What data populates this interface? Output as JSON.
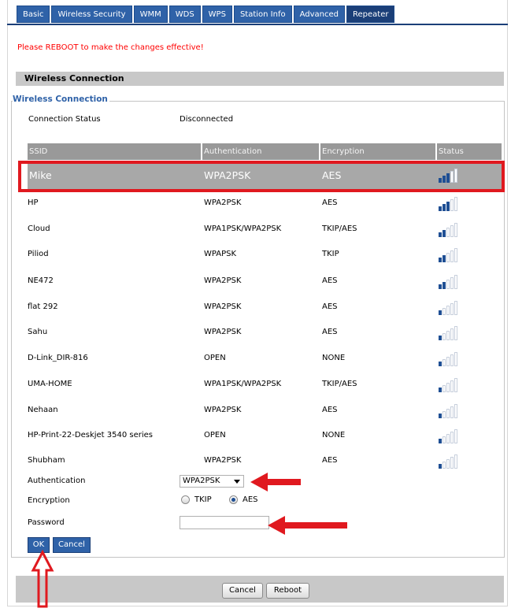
{
  "tabs": [
    {
      "label": "Basic"
    },
    {
      "label": "Wireless Security"
    },
    {
      "label": "WMM"
    },
    {
      "label": "WDS"
    },
    {
      "label": "WPS"
    },
    {
      "label": "Station Info"
    },
    {
      "label": "Advanced"
    },
    {
      "label": "Repeater",
      "active": true
    }
  ],
  "notice": "Please REBOOT to make the changes effective!",
  "section_title": "Wireless Connection",
  "group_legend": "Wireless Connection",
  "connection_status": {
    "label": "Connection Status",
    "value": "Disconnected"
  },
  "table": {
    "headers": {
      "ssid": "SSID",
      "auth": "Authentication",
      "enc": "Encryption",
      "status": "Status"
    },
    "rows": [
      {
        "ssid": "Mike",
        "auth": "WPA2PSK",
        "enc": "AES",
        "signal": 3,
        "selected": true
      },
      {
        "ssid": "HP",
        "auth": "WPA2PSK",
        "enc": "AES",
        "signal": 3
      },
      {
        "ssid": "Cloud",
        "auth": "WPA1PSK/WPA2PSK",
        "enc": "TKIP/AES",
        "signal": 2
      },
      {
        "ssid": "Piliod",
        "auth": "WPAPSK",
        "enc": "TKIP",
        "signal": 2
      },
      {
        "ssid": "NE472",
        "auth": "WPA2PSK",
        "enc": "AES",
        "signal": 2
      },
      {
        "ssid": "flat 292",
        "auth": "WPA2PSK",
        "enc": "AES",
        "signal": 1
      },
      {
        "ssid": "Sahu",
        "auth": "WPA2PSK",
        "enc": "AES",
        "signal": 1
      },
      {
        "ssid": "D-Link_DIR-816",
        "auth": "OPEN",
        "enc": "NONE",
        "signal": 1
      },
      {
        "ssid": "UMA-HOME",
        "auth": "WPA1PSK/WPA2PSK",
        "enc": "TKIP/AES",
        "signal": 1
      },
      {
        "ssid": "Nehaan",
        "auth": "WPA2PSK",
        "enc": "AES",
        "signal": 1
      },
      {
        "ssid": "HP-Print-22-Deskjet 3540 series",
        "auth": "OPEN",
        "enc": "NONE",
        "signal": 1
      },
      {
        "ssid": "Shubham",
        "auth": "WPA2PSK",
        "enc": "AES",
        "signal": 1
      }
    ]
  },
  "form": {
    "auth_label": "Authentication",
    "auth_value": "WPA2PSK",
    "enc_label": "Encryption",
    "enc_options": [
      "TKIP",
      "AES"
    ],
    "enc_selected": "AES",
    "password_label": "Password",
    "password_value": ""
  },
  "buttons": {
    "ok": "OK",
    "cancel": "Cancel",
    "footer_cancel": "Cancel",
    "reboot": "Reboot"
  },
  "colors": {
    "tab_bg": "#2f62a8",
    "notice": "#ff0000",
    "annotation": "#e0191f",
    "signal_on": "#1f4f94"
  }
}
